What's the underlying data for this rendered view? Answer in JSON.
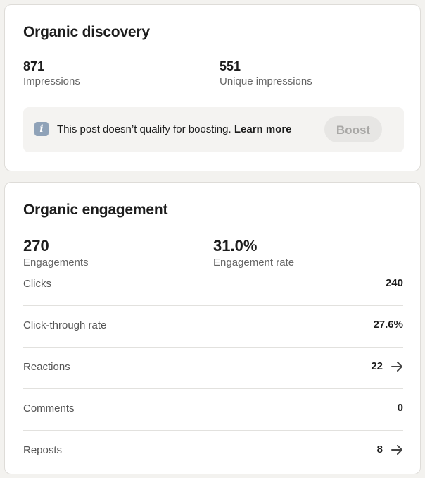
{
  "organic_discovery": {
    "title": "Organic discovery",
    "metrics": [
      {
        "value": "871",
        "label": "Impressions"
      },
      {
        "value": "551",
        "label": "Unique impressions"
      }
    ],
    "notice": {
      "text": "This post doesn’t qualify for boosting.",
      "link": "Learn more",
      "button": "Boost"
    }
  },
  "organic_engagement": {
    "title": "Organic engagement",
    "metrics": [
      {
        "value": "270",
        "label": "Engagements"
      },
      {
        "value": "31.0%",
        "label": "Engagement rate"
      }
    ],
    "rows": [
      {
        "label": "Clicks",
        "value": "240"
      },
      {
        "label": "Click-through rate",
        "value": "27.6%"
      },
      {
        "label": "Reactions",
        "value": "22"
      },
      {
        "label": "Comments",
        "value": "0"
      },
      {
        "label": "Reposts",
        "value": "8"
      }
    ]
  },
  "icons": {
    "info": "info-icon",
    "arrow": "arrow-right-icon"
  }
}
